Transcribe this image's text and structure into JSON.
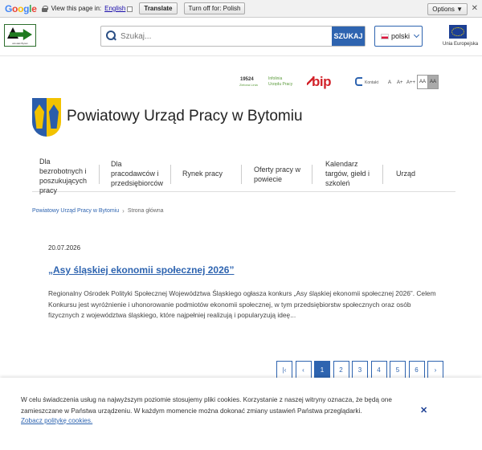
{
  "translate_bar": {
    "logo": "Google",
    "view_text": "View this page in:",
    "language": "English",
    "translate_button": "Translate",
    "turn_off_button": "Turn off for: Polish",
    "options_button": "Options ▼",
    "close": "✕"
  },
  "header": {
    "logo_caption": "ośrodek Bytom",
    "search_placeholder": "Szukaj...",
    "search_button": "SZUKAJ",
    "language_label": "polski",
    "eu_caption": "Unia Europejska"
  },
  "utility": {
    "infolinia_number": "19524",
    "infolinia_sub": "Zielona Linia",
    "infolinia_line1": "Infolinia",
    "infolinia_line2": "Urzędu Pracy",
    "bip": "bip",
    "kontakt": "Kontakt",
    "font_a": "A",
    "font_a_plus": "A+",
    "font_a_plus_plus": "A++",
    "contrast_1": "AA",
    "contrast_2": "AA"
  },
  "site_title": "Powiatowy Urząd Pracy w Bytomiu",
  "nav": [
    {
      "line1": "Dla",
      "line2": "bezrobotnych i",
      "line3": "poszukujących",
      "line4": "pracy"
    },
    {
      "line1": "Dla",
      "line2": "pracodawców i",
      "line3": "przedsiębiorców"
    },
    {
      "line1": "Rynek pracy"
    },
    {
      "line1": "Oferty pracy w",
      "line2": "powiecie"
    },
    {
      "line1": "Kalendarz",
      "line2": "targów, giełd i",
      "line3": "szkoleń"
    },
    {
      "line1": "Urząd"
    }
  ],
  "breadcrumb": {
    "home": "Powiatowy Urząd Pracy w Bytomiu",
    "separator": "›",
    "current": "Strona główna"
  },
  "article": {
    "date": "20.07.2026",
    "title": "„Asy śląskiej ekonomii społecznej 2026”",
    "text": "Regionalny Ośrodek Polityki Społecznej Województwa Śląskiego ogłasza konkurs „Asy śląskiej ekonomii społecznej 2026”. Celem Konkursu jest wyróżnienie i uhonorowanie podmiotów ekonomii społecznej, w tym przedsiębiorstw społecznych oraz osób fizycznych z województwa śląskiego, które najpełniej realizują i popularyzują ideę..."
  },
  "pagination": {
    "first": "|‹",
    "prev": "‹",
    "pages": [
      "1",
      "2",
      "3",
      "4",
      "5",
      "6"
    ],
    "next": "›",
    "current": "1"
  },
  "cookie": {
    "text": "W celu świadczenia usług na najwyższym poziomie stosujemy pliki cookies. Korzystanie z naszej witryny oznacza, że będą one zamieszczane w Państwa urządzeniu. W każdym momencie można dokonać zmiany ustawień Państwa przeglądarki.",
    "link": "Zobacz politykę cookies.",
    "close": "✕"
  },
  "colors": {
    "accent": "#2e64b0",
    "bip_red": "#d2232a",
    "eu_blue": "#1c3f94"
  }
}
